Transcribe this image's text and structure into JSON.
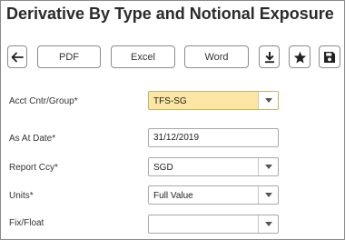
{
  "page": {
    "title": "Derivative By Type and Notional Exposure"
  },
  "toolbar": {
    "back_icon": "arrow-left-icon",
    "pdf_label": "PDF",
    "excel_label": "Excel",
    "word_label": "Word",
    "download_icon": "download-icon",
    "favorite_icon": "star-icon",
    "save_icon": "floppy-disk-icon"
  },
  "form": {
    "acct_label": "Acct Cntr/Group*",
    "acct_value": "TFS-SG",
    "as_at_label": "As At Date*",
    "as_at_value": "31/12/2019",
    "ccy_label": "Report Ccy*",
    "ccy_value": "SGD",
    "units_label": "Units*",
    "units_value": "Full Value",
    "fixfloat_label": "Fix/Float",
    "fixfloat_value": ""
  },
  "colors": {
    "highlight_field": "#fbe6a3",
    "border": "#8c8c8c"
  }
}
